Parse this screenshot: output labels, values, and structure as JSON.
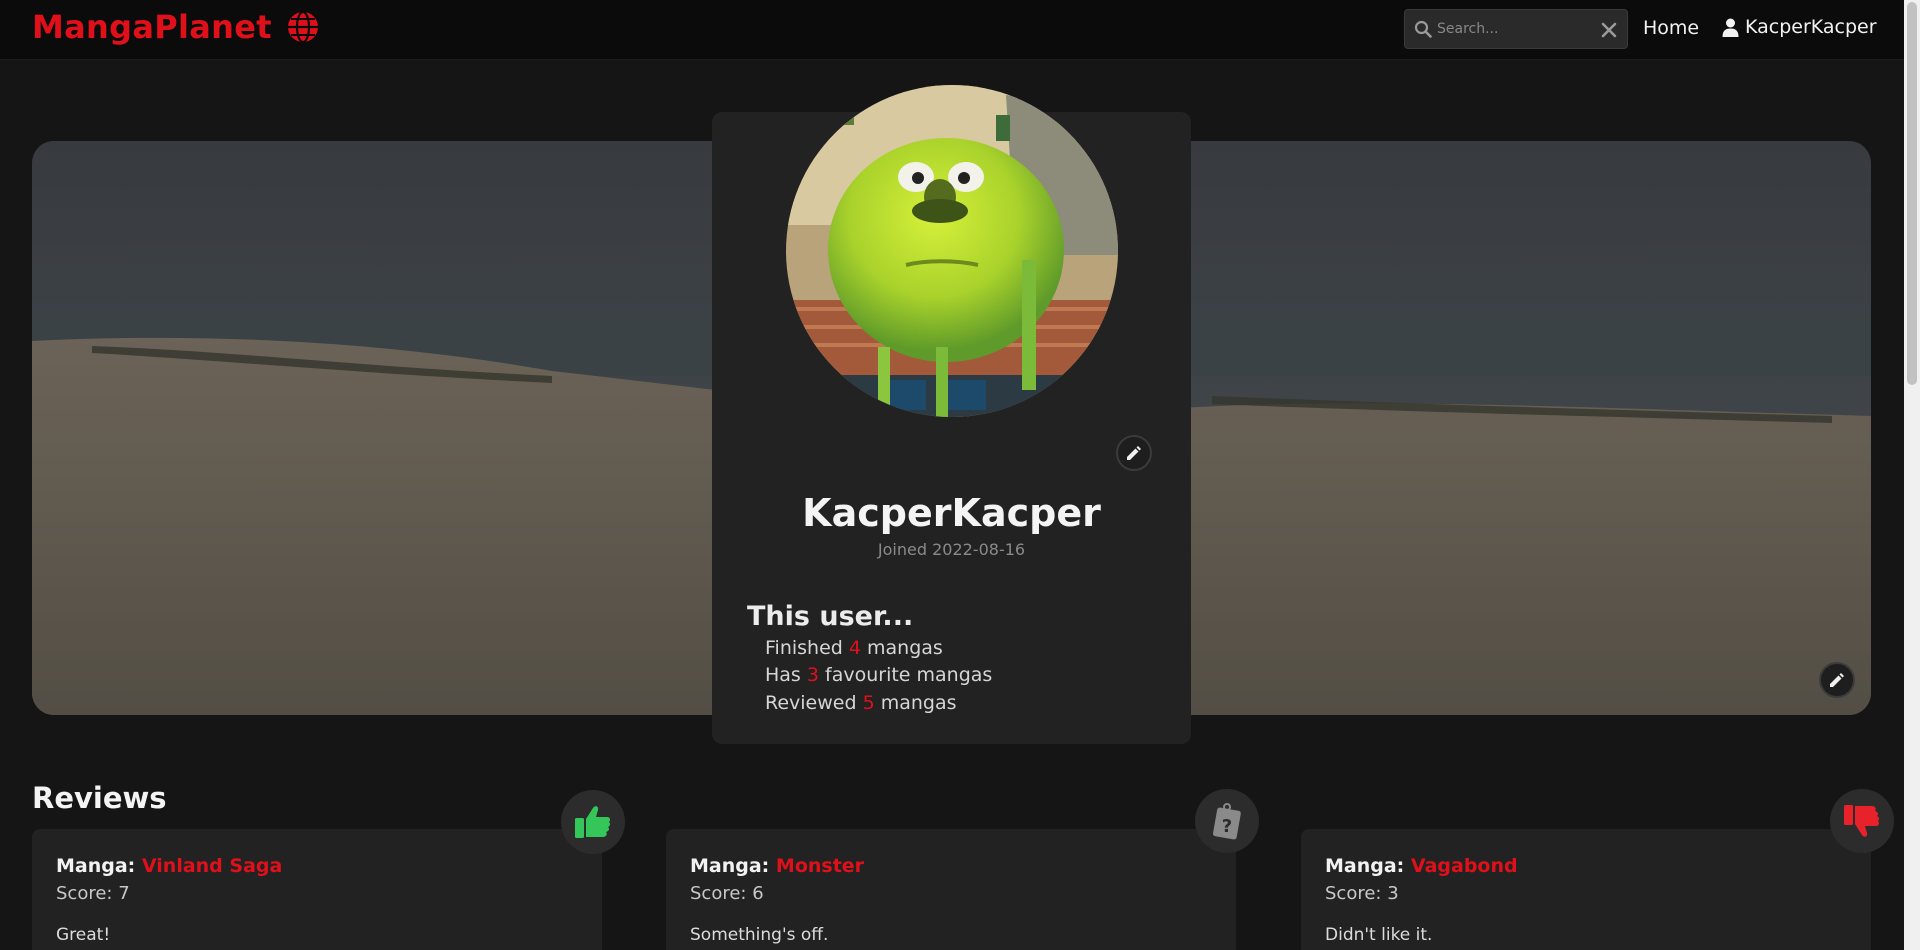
{
  "navbar": {
    "brand": "MangaPlanet",
    "brand_icon": "globe-icon",
    "search_placeholder": "Search...",
    "home_label": "Home",
    "user_label": "KacperKacper"
  },
  "profile": {
    "username": "KacperKacper",
    "joined": "Joined 2022-08-16",
    "stats_title": "This user...",
    "stats": [
      {
        "prefix": "Finished ",
        "count": "4",
        "suffix": " mangas"
      },
      {
        "prefix": "Has ",
        "count": "3",
        "suffix": " favourite mangas"
      },
      {
        "prefix": "Reviewed ",
        "count": "5",
        "suffix": " mangas"
      }
    ]
  },
  "reviews": {
    "title": "Reviews",
    "manga_label": "Manga:",
    "items": [
      {
        "manga": "Vinland Saga",
        "score": "Score: 7",
        "text": "Great!",
        "icon": "thumbs-up-icon",
        "icon_color": "#35c65a"
      },
      {
        "manga": "Monster",
        "score": "Score: 6",
        "text": "Something's off.",
        "icon": "question-tag-icon",
        "icon_color": "#8a8a8a"
      },
      {
        "manga": "Vagabond",
        "score": "Score: 3",
        "text": "Didn't like it.",
        "icon": "thumbs-down-icon",
        "icon_color": "#e8222b"
      }
    ]
  },
  "colors": {
    "accent": "#e0101b",
    "background": "#151515",
    "card": "#222222",
    "navbar": "#0b0b0b"
  }
}
